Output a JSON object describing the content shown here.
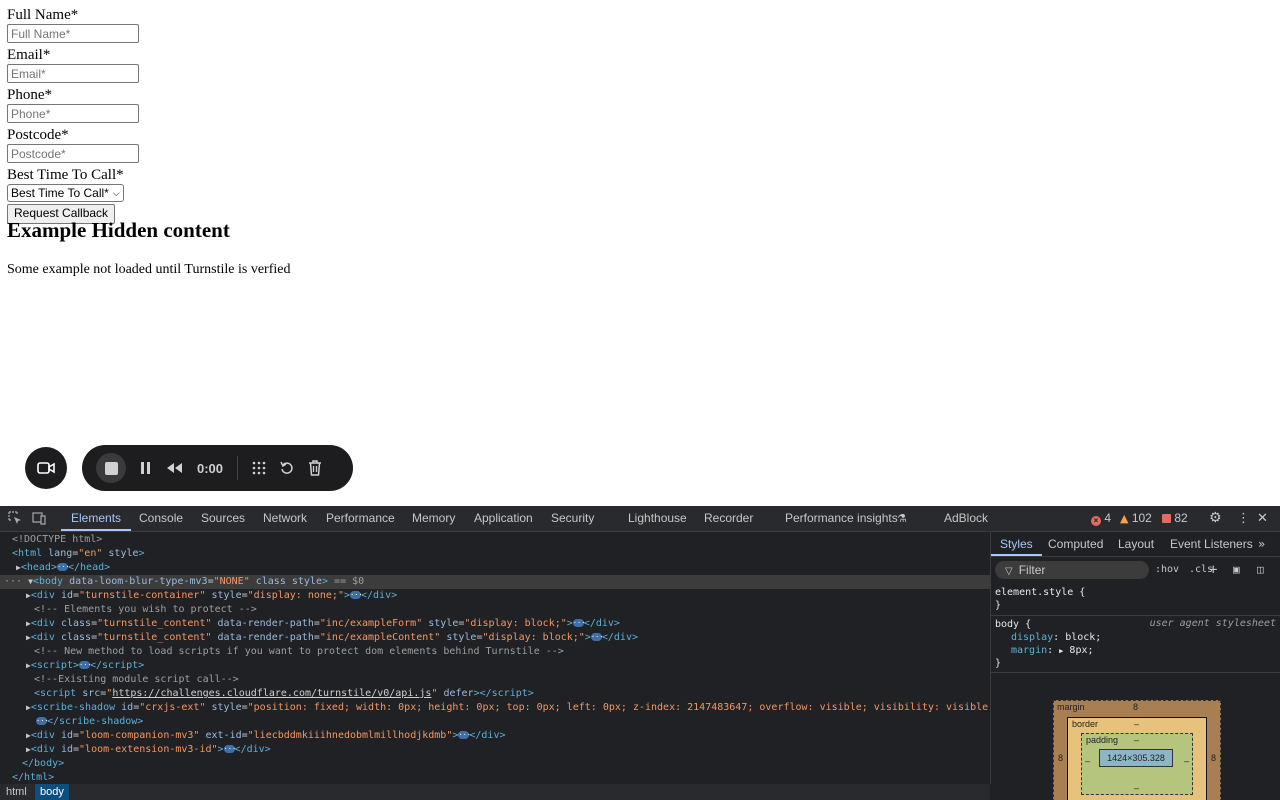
{
  "form": {
    "fields": [
      {
        "label": "Full Name*",
        "placeholder": "Full Name*"
      },
      {
        "label": "Email*",
        "placeholder": "Email*"
      },
      {
        "label": "Phone*",
        "placeholder": "Phone*"
      },
      {
        "label": "Postcode*",
        "placeholder": "Postcode*"
      }
    ],
    "select_label": "Best Time To Call*",
    "select_value": "Best Time To Call*",
    "submit_label": "Request Callback"
  },
  "hidden": {
    "title": "Example Hidden content",
    "text": "Some example not loaded until Turnstile is verfied"
  },
  "recorder": {
    "time": "0:00"
  },
  "devtools": {
    "tabs": [
      "Elements",
      "Console",
      "Sources",
      "Network",
      "Performance",
      "Memory",
      "Application",
      "Security",
      "Lighthouse",
      "Recorder",
      "Performance insights",
      "AdBlock"
    ],
    "errors": "4",
    "warnings": "102",
    "issues": "82",
    "dom": {
      "doctype": "<!DOCTYPE html>",
      "l1_tag": "html",
      "l1_attr": "lang",
      "l1_val": "\"en\"",
      "l1_attr2": "style",
      "l2_tag": "head",
      "l3_tag": "body",
      "l3_attr": "data-loom-blur-type-mv3",
      "l3_val": "\"NONE\"",
      "l3_rest": "class style",
      "l3_dollar": "== $0",
      "l4_attr_val": "\"turnstile-container\"",
      "l4_style_val": "\"display: none;\"",
      "l5_comment": "<!-- Elements you wish to protect -->",
      "l6_val1": "\"turnstile_content\"",
      "l6_val2": "\"inc/exampleForm\"",
      "l6_val3": "\"display: block;\"",
      "l7_val1": "\"turnstile_content\"",
      "l7_val2": "\"inc/exampleContent\"",
      "l7_val3": "\"display: block;\"",
      "l8_comment": "<!-- New method to load scripts if you want to protect dom elements behind Turnstile -->",
      "l10_comment": "<!--Existing module script call-->",
      "l11_src": "https://challenges.cloudflare.com/turnstile/v0/api.js",
      "l12_id": "\"crxjs-ext\"",
      "l12_style": "\"position: fixed; width: 0px; height: 0px; top: 0px; left: 0px; z-index: 2147483647; overflow: visible; visibility: visible;\"",
      "l14_id": "\"loom-companion-mv3\"",
      "l14_ext": "\"liecbddmkiiihnedobmlmillhodjkdmb\"",
      "l15_id": "\"loom-extension-mv3-id\""
    },
    "breadcrumbs": [
      "html",
      "body"
    ],
    "styles": {
      "tabs": [
        "Styles",
        "Computed",
        "Layout",
        "Event Listeners"
      ],
      "filter_placeholder": "Filter",
      "hov": ":hov",
      "cls": ".cls",
      "element_style": "element.style {",
      "close": "}",
      "body_selector": "body {",
      "ua_label": "user agent stylesheet",
      "display_prop": "display",
      "display_val": "block;",
      "margin_prop": "margin",
      "margin_val": "8px;",
      "box_margin": "margin",
      "box_border": "border",
      "box_padding": "padding",
      "margin_value": "8",
      "dash": "–",
      "content_size": "1424×305.328"
    }
  }
}
